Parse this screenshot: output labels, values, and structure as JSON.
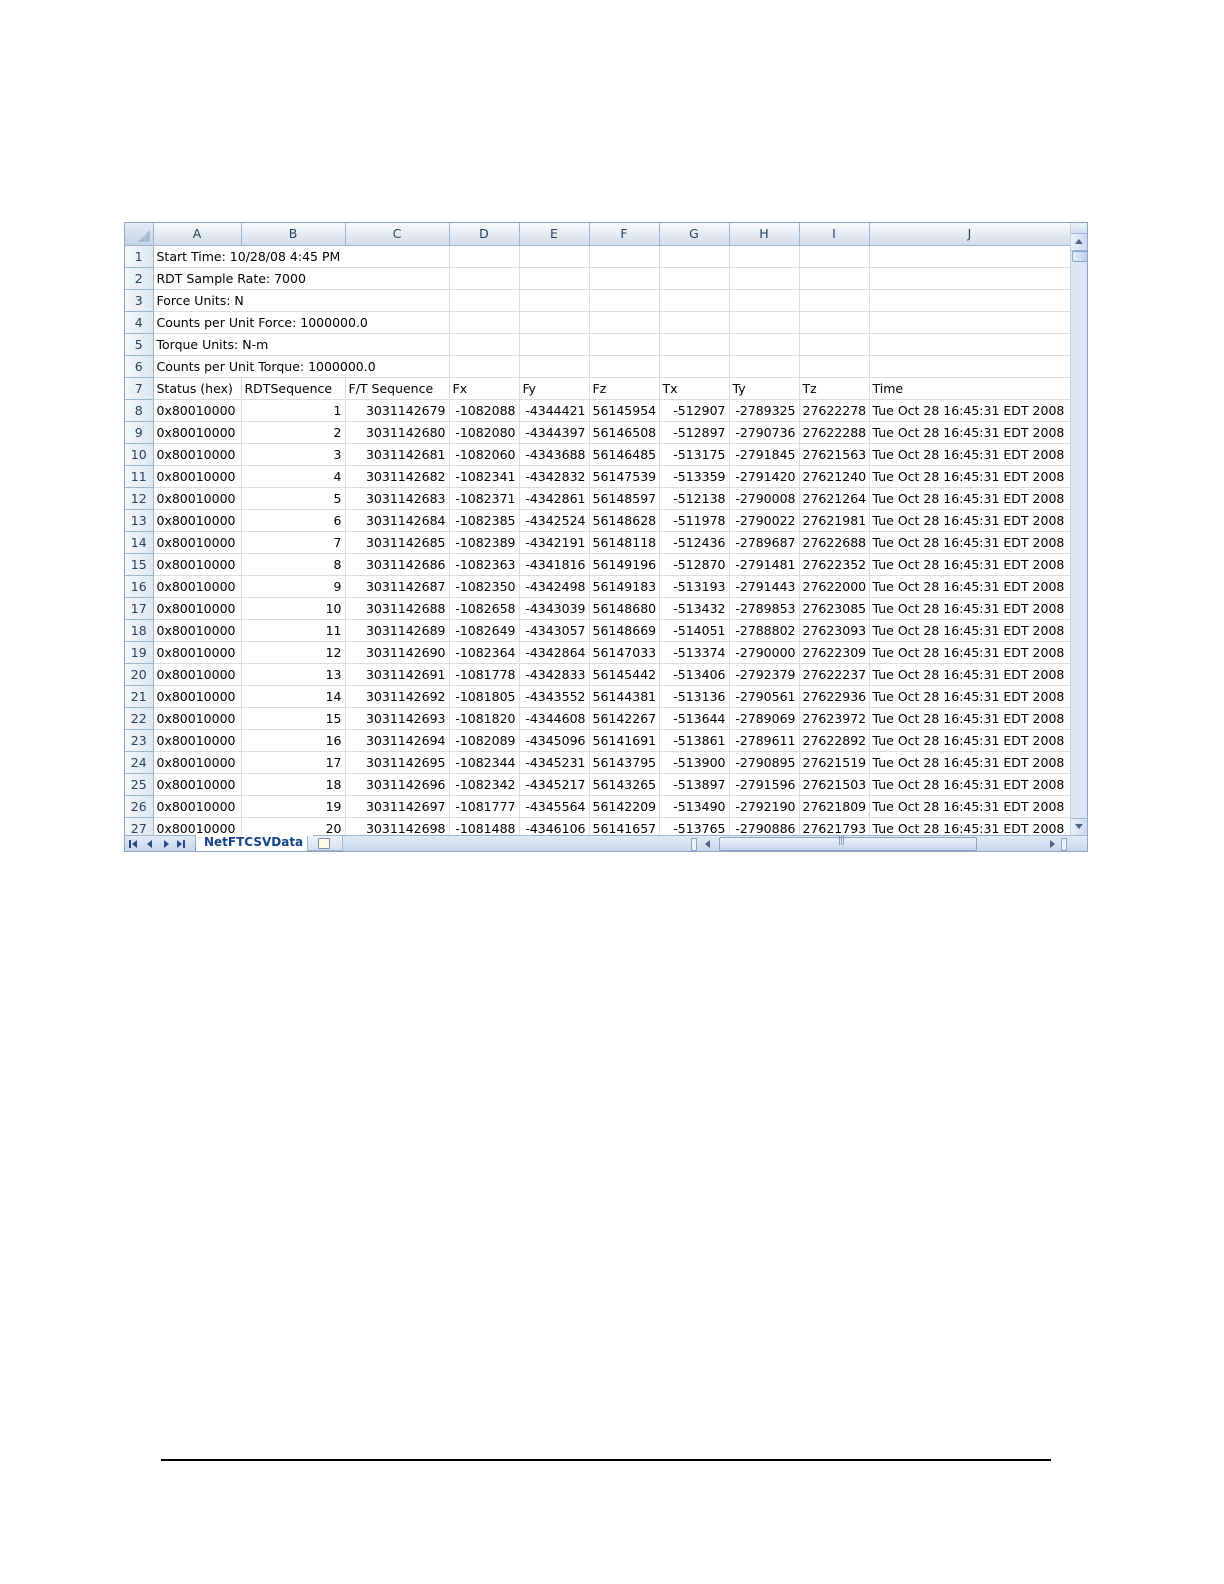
{
  "sheet_tab": "NetFTCSVData",
  "columns": [
    "A",
    "B",
    "C",
    "D",
    "E",
    "F",
    "G",
    "H",
    "I",
    "J"
  ],
  "metadata_rows": [
    {
      "row": "1",
      "text": "Start Time: 10/28/08 4:45 PM"
    },
    {
      "row": "2",
      "text": "RDT Sample Rate: 7000"
    },
    {
      "row": "3",
      "text": "Force Units: N"
    },
    {
      "row": "4",
      "text": "Counts per Unit Force: 1000000.0"
    },
    {
      "row": "5",
      "text": "Torque Units: N-m"
    },
    {
      "row": "6",
      "text": "Counts per Unit Torque: 1000000.0"
    }
  ],
  "header_row": {
    "row": "7",
    "cells": [
      "Status (hex)",
      "RDTSequence",
      "F/T Sequence",
      "Fx",
      "Fy",
      "Fz",
      "Tx",
      "Ty",
      "Tz",
      "Time"
    ]
  },
  "data_rows": [
    {
      "row": "8",
      "cells": [
        "0x80010000",
        "1",
        "3031142679",
        "-1082088",
        "-4344421",
        "56145954",
        "-512907",
        "-2789325",
        "27622278",
        "Tue Oct 28 16:45:31 EDT 2008"
      ]
    },
    {
      "row": "9",
      "cells": [
        "0x80010000",
        "2",
        "3031142680",
        "-1082080",
        "-4344397",
        "56146508",
        "-512897",
        "-2790736",
        "27622288",
        "Tue Oct 28 16:45:31 EDT 2008"
      ]
    },
    {
      "row": "10",
      "cells": [
        "0x80010000",
        "3",
        "3031142681",
        "-1082060",
        "-4343688",
        "56146485",
        "-513175",
        "-2791845",
        "27621563",
        "Tue Oct 28 16:45:31 EDT 2008"
      ]
    },
    {
      "row": "11",
      "cells": [
        "0x80010000",
        "4",
        "3031142682",
        "-1082341",
        "-4342832",
        "56147539",
        "-513359",
        "-2791420",
        "27621240",
        "Tue Oct 28 16:45:31 EDT 2008"
      ]
    },
    {
      "row": "12",
      "cells": [
        "0x80010000",
        "5",
        "3031142683",
        "-1082371",
        "-4342861",
        "56148597",
        "-512138",
        "-2790008",
        "27621264",
        "Tue Oct 28 16:45:31 EDT 2008"
      ]
    },
    {
      "row": "13",
      "cells": [
        "0x80010000",
        "6",
        "3031142684",
        "-1082385",
        "-4342524",
        "56148628",
        "-511978",
        "-2790022",
        "27621981",
        "Tue Oct 28 16:45:31 EDT 2008"
      ]
    },
    {
      "row": "14",
      "cells": [
        "0x80010000",
        "7",
        "3031142685",
        "-1082389",
        "-4342191",
        "56148118",
        "-512436",
        "-2789687",
        "27622688",
        "Tue Oct 28 16:45:31 EDT 2008"
      ]
    },
    {
      "row": "15",
      "cells": [
        "0x80010000",
        "8",
        "3031142686",
        "-1082363",
        "-4341816",
        "56149196",
        "-512870",
        "-2791481",
        "27622352",
        "Tue Oct 28 16:45:31 EDT 2008"
      ]
    },
    {
      "row": "16",
      "cells": [
        "0x80010000",
        "9",
        "3031142687",
        "-1082350",
        "-4342498",
        "56149183",
        "-513193",
        "-2791443",
        "27622000",
        "Tue Oct 28 16:45:31 EDT 2008"
      ]
    },
    {
      "row": "17",
      "cells": [
        "0x80010000",
        "10",
        "3031142688",
        "-1082658",
        "-4343039",
        "56148680",
        "-513432",
        "-2789853",
        "27623085",
        "Tue Oct 28 16:45:31 EDT 2008"
      ]
    },
    {
      "row": "18",
      "cells": [
        "0x80010000",
        "11",
        "3031142689",
        "-1082649",
        "-4343057",
        "56148669",
        "-514051",
        "-2788802",
        "27623093",
        "Tue Oct 28 16:45:31 EDT 2008"
      ]
    },
    {
      "row": "19",
      "cells": [
        "0x80010000",
        "12",
        "3031142690",
        "-1082364",
        "-4342864",
        "56147033",
        "-513374",
        "-2790000",
        "27622309",
        "Tue Oct 28 16:45:31 EDT 2008"
      ]
    },
    {
      "row": "20",
      "cells": [
        "0x80010000",
        "13",
        "3031142691",
        "-1081778",
        "-4342833",
        "56145442",
        "-513406",
        "-2792379",
        "27622237",
        "Tue Oct 28 16:45:31 EDT 2008"
      ]
    },
    {
      "row": "21",
      "cells": [
        "0x80010000",
        "14",
        "3031142692",
        "-1081805",
        "-4343552",
        "56144381",
        "-513136",
        "-2790561",
        "27622936",
        "Tue Oct 28 16:45:31 EDT 2008"
      ]
    },
    {
      "row": "22",
      "cells": [
        "0x80010000",
        "15",
        "3031142693",
        "-1081820",
        "-4344608",
        "56142267",
        "-513644",
        "-2789069",
        "27623972",
        "Tue Oct 28 16:45:31 EDT 2008"
      ]
    },
    {
      "row": "23",
      "cells": [
        "0x80010000",
        "16",
        "3031142694",
        "-1082089",
        "-4345096",
        "56141691",
        "-513861",
        "-2789611",
        "27622892",
        "Tue Oct 28 16:45:31 EDT 2008"
      ]
    },
    {
      "row": "24",
      "cells": [
        "0x80010000",
        "17",
        "3031142695",
        "-1082344",
        "-4345231",
        "56143795",
        "-513900",
        "-2790895",
        "27621519",
        "Tue Oct 28 16:45:31 EDT 2008"
      ]
    },
    {
      "row": "25",
      "cells": [
        "0x80010000",
        "18",
        "3031142696",
        "-1082342",
        "-4345217",
        "56143265",
        "-513897",
        "-2791596",
        "27621503",
        "Tue Oct 28 16:45:31 EDT 2008"
      ]
    },
    {
      "row": "26",
      "cells": [
        "0x80010000",
        "19",
        "3031142697",
        "-1081777",
        "-4345564",
        "56142209",
        "-513490",
        "-2792190",
        "27621809",
        "Tue Oct 28 16:45:31 EDT 2008"
      ]
    },
    {
      "row": "27",
      "cells": [
        "0x80010000",
        "20",
        "3031142698",
        "-1081488",
        "-4346106",
        "56141657",
        "-513765",
        "-2790886",
        "27621793",
        "Tue Oct 28 16:45:31 EDT 2008"
      ]
    }
  ],
  "colors": {
    "header_gradient_top": "#f9fcfd",
    "header_gradient_bottom": "#d3dbe9",
    "header_text": "#27415f",
    "gridline": "#dadcdd",
    "tab_text": "#15428b",
    "scroll_track": "#dde6f2"
  }
}
